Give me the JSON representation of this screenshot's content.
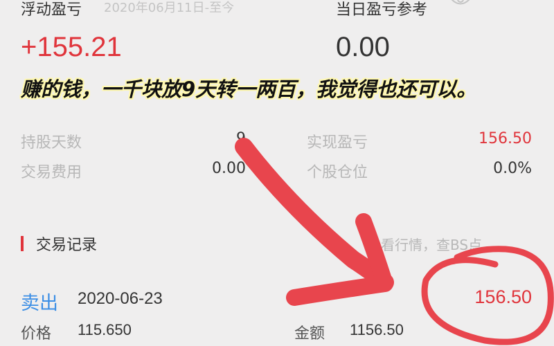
{
  "header": {
    "floating_label": "浮动盈亏",
    "date_text": "2020年06月11日-至今",
    "today_label": "当日盈亏参考"
  },
  "summary": {
    "floating_value": "+155.21",
    "today_value": "0.00"
  },
  "caption": "赚的钱，一千块放9天转一两百，我觉得也还可以。",
  "stats": {
    "hold_days_label": "持股天数",
    "hold_days_value": "9",
    "fee_label": "交易费用",
    "fee_value": "0.00",
    "realized_label": "实现盈亏",
    "realized_value": "156.50",
    "position_label": "个股仓位",
    "position_value": "0.0%"
  },
  "records": {
    "title": "交易记录",
    "link": "看行情，查BS点",
    "items": [
      {
        "type": "卖出",
        "date": "2020-06-23",
        "amount": "156.50",
        "price_label": "价格",
        "price": "115.650",
        "total_label": "金额",
        "total": "1156.50"
      }
    ]
  },
  "colors": {
    "red": "#e0343b",
    "blue": "#3b8ee5",
    "annotation": "#e8454d",
    "background": "#efeeee"
  }
}
